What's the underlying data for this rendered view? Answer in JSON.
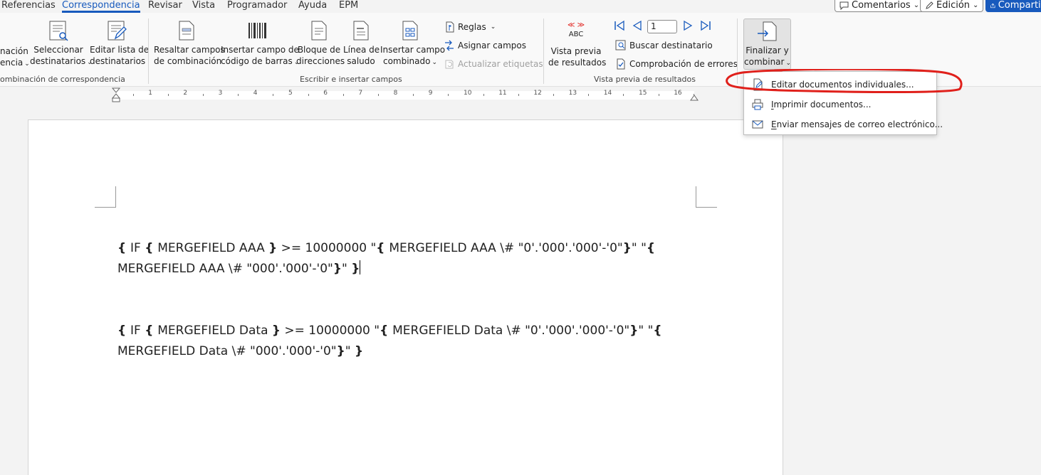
{
  "tabs": [
    {
      "label": "Referencias",
      "active": false
    },
    {
      "label": "Correspondencia",
      "active": true
    },
    {
      "label": "Revisar",
      "active": false
    },
    {
      "label": "Vista",
      "active": false
    },
    {
      "label": "Programador",
      "active": false
    },
    {
      "label": "Ayuda",
      "active": false
    },
    {
      "label": "EPM",
      "active": false
    }
  ],
  "top_right": {
    "comments": "Comentarios",
    "editing": "Edición",
    "share": "Compartir"
  },
  "ribbon": {
    "start_merge_partial": [
      "nación",
      "encia"
    ],
    "select_recipients": [
      "Seleccionar",
      "destinatarios"
    ],
    "edit_list": [
      "Editar lista de",
      "destinatarios"
    ],
    "highlight_fields": [
      "Resaltar campos",
      "de combinación"
    ],
    "barcode": [
      "Insertar campo de",
      "código de barras"
    ],
    "address_block": [
      "Bloque de",
      "direcciones"
    ],
    "greeting_line": [
      "Línea de",
      "saludo"
    ],
    "insert_merge_field": [
      "Insertar campo",
      "combinado"
    ],
    "rules": "Reglas",
    "match_fields": "Asignar campos",
    "update_labels": "Actualizar etiquetas",
    "preview_abc": "ABC",
    "preview_results": [
      "Vista previa",
      "de resultados"
    ],
    "record_number": "1",
    "find_recipient": "Buscar destinatario",
    "check_errors": "Comprobación de errores",
    "finish_merge": [
      "Finalizar y",
      "combinar"
    ],
    "groups": {
      "start_merge": "ombinación de correspondencia",
      "write_insert": "Escribir e insertar campos",
      "preview": "Vista previa de resultados"
    }
  },
  "ruler_numbers": [
    "1",
    "2",
    "3",
    "4",
    "5",
    "6",
    "7",
    "8",
    "9",
    "10",
    "11",
    "12",
    "13",
    "14",
    "15",
    "16"
  ],
  "document": {
    "line1": {
      "p1": "{ ",
      "p2": "IF ",
      "p3": "{ ",
      "p4": "MERGEFIELD AAA ",
      "p5": "}",
      "p6": " >= 10000000 \"",
      "p7": "{ ",
      "p8": "MERGEFIELD AAA \\# \"0'.'000'.'000'-'0\"",
      "p9": "}",
      "p10": "\" \"",
      "p11": "{"
    },
    "line2": {
      "p1": "MERGEFIELD AAA \\# \"000'.'000'-'0\"",
      "p2": "}",
      "p3": "\" ",
      "p4": "}"
    },
    "line3": {
      "p1": "{ ",
      "p2": "IF ",
      "p3": "{ ",
      "p4": "MERGEFIELD Data ",
      "p5": "}",
      "p6": " >= 10000000 \"",
      "p7": "{ ",
      "p8": "MERGEFIELD Data \\# \"0'.'000'.'000'-'0\"",
      "p9": "}",
      "p10": "\" \"",
      "p11": "{"
    },
    "line4": {
      "p1": "MERGEFIELD Data \\# \"000'.'000'-'0\"",
      "p2": "}",
      "p3": "\" ",
      "p4": "}"
    }
  },
  "dropdown": {
    "items": [
      {
        "key": "E",
        "rest": "ditar documentos individuales..."
      },
      {
        "key": "I",
        "rest": "mprimir documentos..."
      },
      {
        "key": "E",
        "rest": "nviar mensajes de correo electrónico..."
      }
    ]
  },
  "colors": {
    "accent": "#185abd",
    "annotation": "#e0201b"
  }
}
